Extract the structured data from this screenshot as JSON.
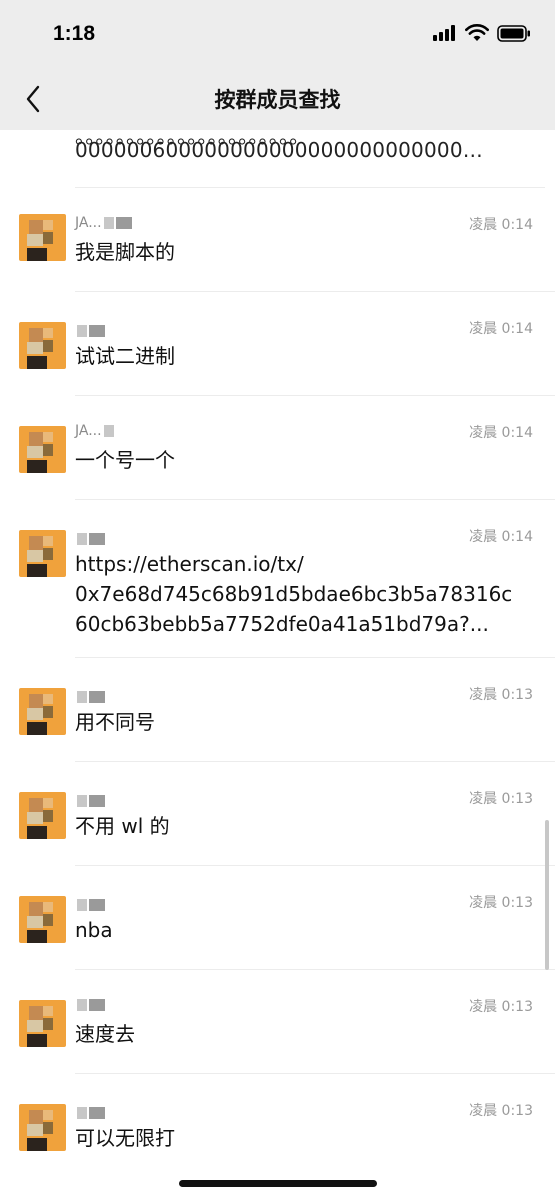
{
  "status": {
    "time": "1:18"
  },
  "header": {
    "title": "按群成员查找"
  },
  "top_snippet": "000000600000000000000000000000…",
  "results": [
    {
      "name": "JA...",
      "time": "凌晨 0:14",
      "message": "我是脚本的"
    },
    {
      "name": "",
      "time": "凌晨 0:14",
      "message": "试试二进制"
    },
    {
      "name": "JA...",
      "time": "凌晨 0:14",
      "message": "一个号一个"
    },
    {
      "name": "",
      "time": "凌晨 0:14",
      "message": "https://etherscan.io/tx/\n0x7e68d745c68b91d5bdae6bc3b5a78316c\n60cb63bebb5a7752dfe0a41a51bd79a?..."
    },
    {
      "name": "",
      "time": "凌晨 0:13",
      "message": "用不同号"
    },
    {
      "name": "",
      "time": "凌晨 0:13",
      "message": "不用 wl 的"
    },
    {
      "name": "",
      "time": "凌晨 0:13",
      "message": "nba"
    },
    {
      "name": "",
      "time": "凌晨 0:13",
      "message": "速度去"
    },
    {
      "name": "",
      "time": "凌晨 0:13",
      "message": "可以无限打"
    }
  ],
  "colors": {
    "avatar": "#f0a23c",
    "bar_bg": "#ededed"
  }
}
